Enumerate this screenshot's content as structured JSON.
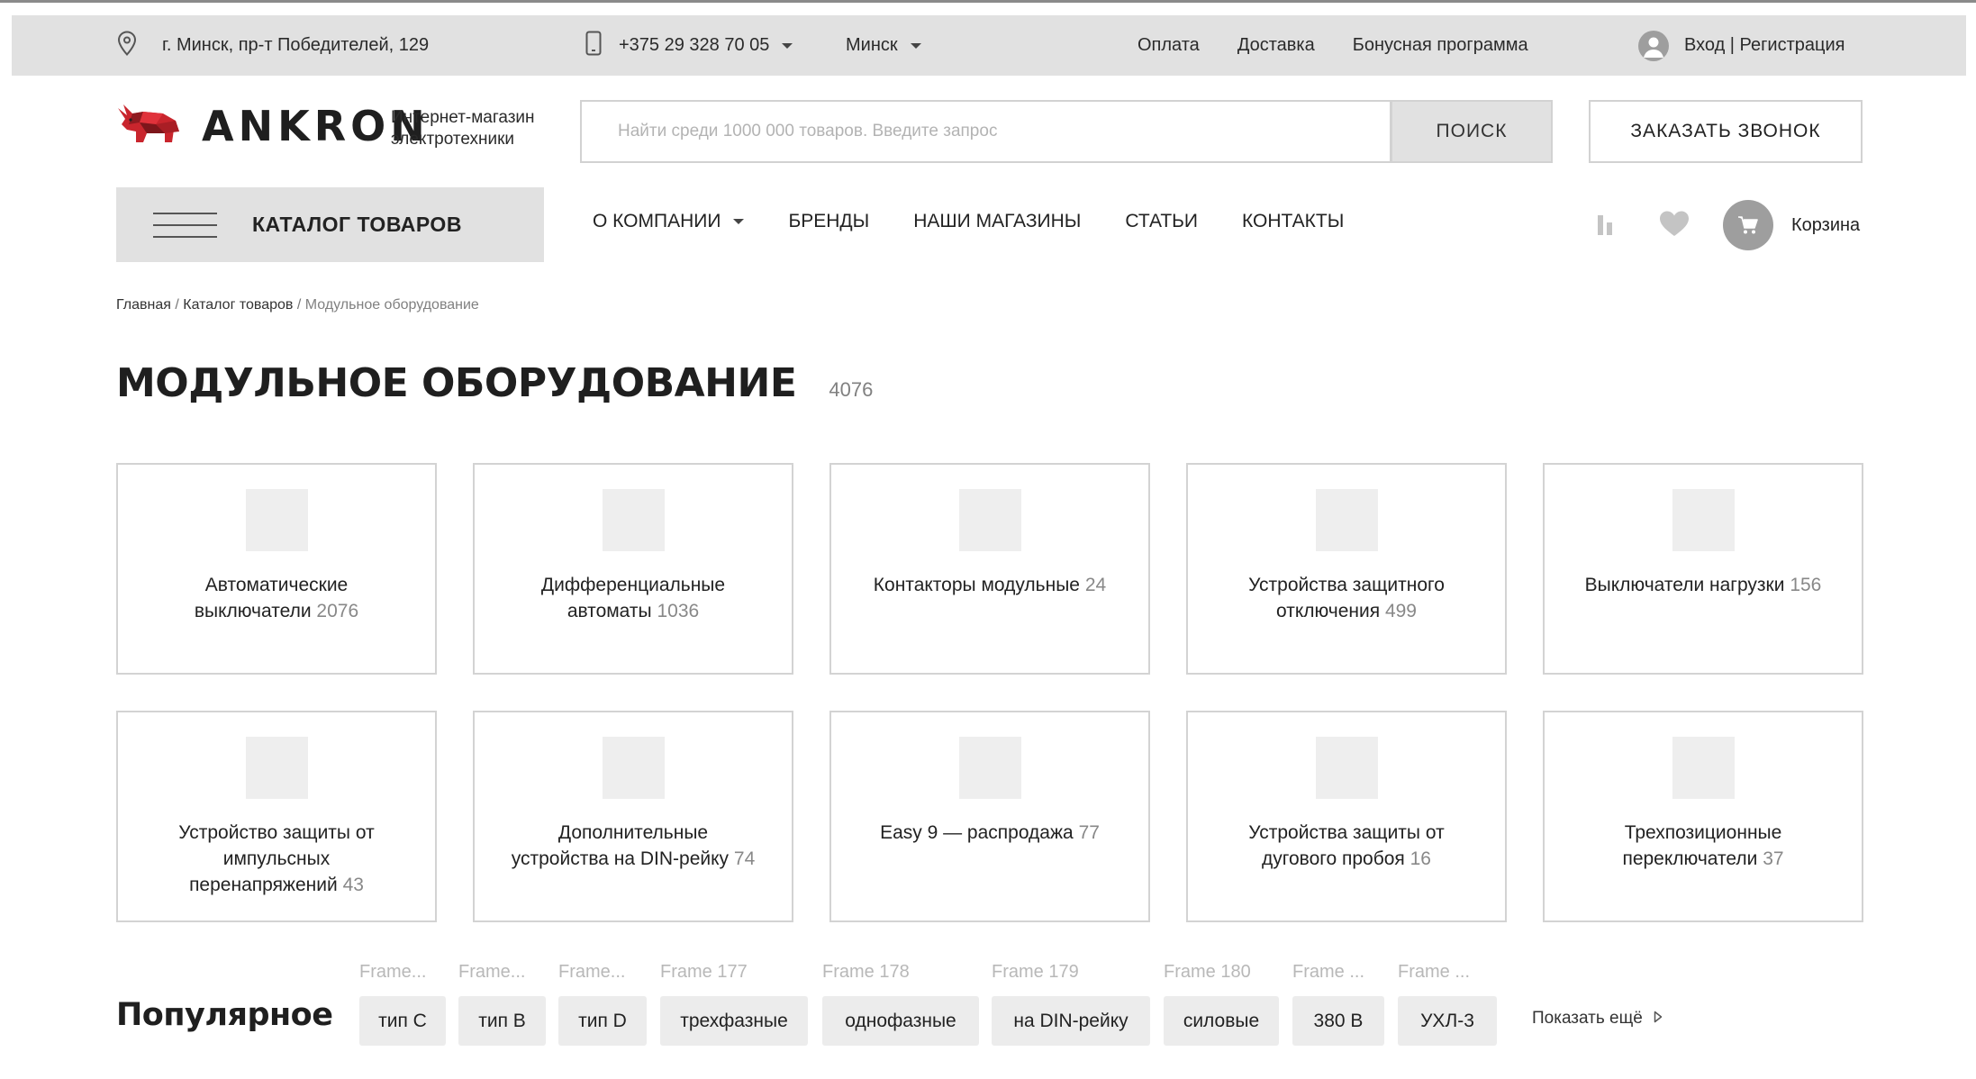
{
  "topbar": {
    "address": "г. Минск, пр-т Победителей, 129",
    "phone": "+375 29 328 70 05",
    "city": "Минск",
    "links": [
      "Оплата",
      "Доставка",
      "Бонусная программа"
    ],
    "login": "Вход | Регистрация"
  },
  "header": {
    "logo_text": "ANKRON",
    "tagline_line1": "Интернет-магазин",
    "tagline_line2": "электротехники",
    "search_placeholder": "Найти среди 1000 000 товаров. Введите запрос",
    "search_button": "ПОИСК",
    "callback_button": "ЗАКАЗАТЬ ЗВОНОК"
  },
  "nav": {
    "catalog_label": "КАТАЛОГ ТОВАРОВ",
    "items": [
      "О КОМПАНИИ",
      "БРЕНДЫ",
      "НАШИ МАГАЗИНЫ",
      "СТАТЬИ",
      "КОНТАКТЫ"
    ],
    "cart_label": "Корзина"
  },
  "breadcrumb": {
    "home": "Главная",
    "catalog": "Каталог товаров",
    "current": "Модульное оборудование"
  },
  "page": {
    "title": "МОДУЛЬНОЕ ОБОРУДОВАНИЕ",
    "count": "4076"
  },
  "categories": [
    {
      "name": "Автоматические выключатели",
      "count": "2076"
    },
    {
      "name": "Дифференциальные автоматы",
      "count": "1036"
    },
    {
      "name": "Контакторы модульные",
      "count": "24"
    },
    {
      "name": "Устройства защитного отключения",
      "count": "499"
    },
    {
      "name": "Выключатели нагрузки",
      "count": "156"
    },
    {
      "name": "Устройство защиты от импульсных перенапряжений",
      "count": "43"
    },
    {
      "name": "Дополнительные устройства на DIN-рейку",
      "count": "74"
    },
    {
      "name": "Easy 9 — распродажа",
      "count": "77"
    },
    {
      "name": "Устройства защиты от дугового пробоя",
      "count": "16"
    },
    {
      "name": "Трехпозиционные переключатели",
      "count": "37"
    }
  ],
  "popular": {
    "title": "Популярное",
    "tags": [
      {
        "frame": "Frame...",
        "label": "тип C"
      },
      {
        "frame": "Frame...",
        "label": "тип B"
      },
      {
        "frame": "Frame...",
        "label": "тип D"
      },
      {
        "frame": "Frame 177",
        "label": "трехфазные"
      },
      {
        "frame": "Frame 178",
        "label": "однофазные"
      },
      {
        "frame": "Frame 179",
        "label": "на DIN-рейку"
      },
      {
        "frame": "Frame 180",
        "label": "силовые"
      },
      {
        "frame": "Frame ...",
        "label": "380 В"
      },
      {
        "frame": "Frame ...",
        "label": "УХЛ-3"
      }
    ],
    "show_more": "Показать ещё"
  },
  "colors": {
    "bar_gray": "#e1e1e1",
    "border_gray": "#d3d3d3",
    "logo_red": "#d0262f",
    "muted_text": "#888888"
  },
  "icons": [
    "location-pin-icon",
    "mobile-phone-icon",
    "user-icon",
    "hamburger-icon",
    "compare-icon",
    "heart-icon",
    "cart-icon",
    "chevron-right-icon"
  ]
}
